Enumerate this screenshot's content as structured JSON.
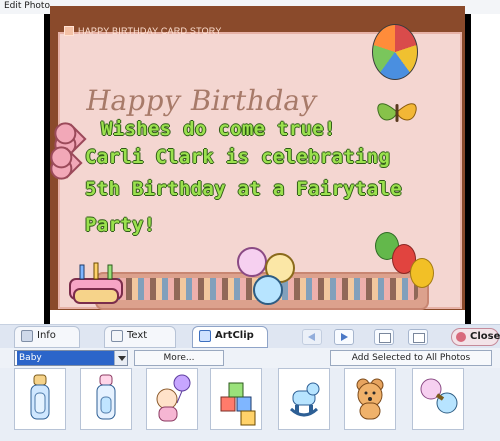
{
  "window": {
    "title": "Edit Photo"
  },
  "card": {
    "header_title": "HAPPY BIRTHDAY CARD STORY",
    "greeting": "Happy Birthday",
    "wishes_lines": [
      "Wishes do come true!",
      "Carli Clark is celebrating",
      "5th Birthday at a Fairytale",
      "Party!"
    ]
  },
  "toolbar": {
    "tabs": [
      {
        "label": "Info"
      },
      {
        "label": "Text"
      },
      {
        "label": "ArtClip"
      }
    ],
    "close_label": "Close"
  },
  "controls": {
    "category_value": "Baby",
    "more_label": "More...",
    "add_selected_label": "Add Selected to All Photos"
  },
  "thumbnails": [
    {
      "name": "bottle-1-icon"
    },
    {
      "name": "bottle-2-icon"
    },
    {
      "name": "baby-with-balloon-icon"
    },
    {
      "name": "toy-blocks-icon"
    },
    {
      "name": "rocking-horse-icon"
    },
    {
      "name": "teddy-bear-icon"
    },
    {
      "name": "rattle-icon"
    }
  ],
  "colors": {
    "accent": "#2c65c9",
    "card_border": "#8a4a2b",
    "text_green": "#9be14e",
    "text_outline": "#2e5b16"
  }
}
